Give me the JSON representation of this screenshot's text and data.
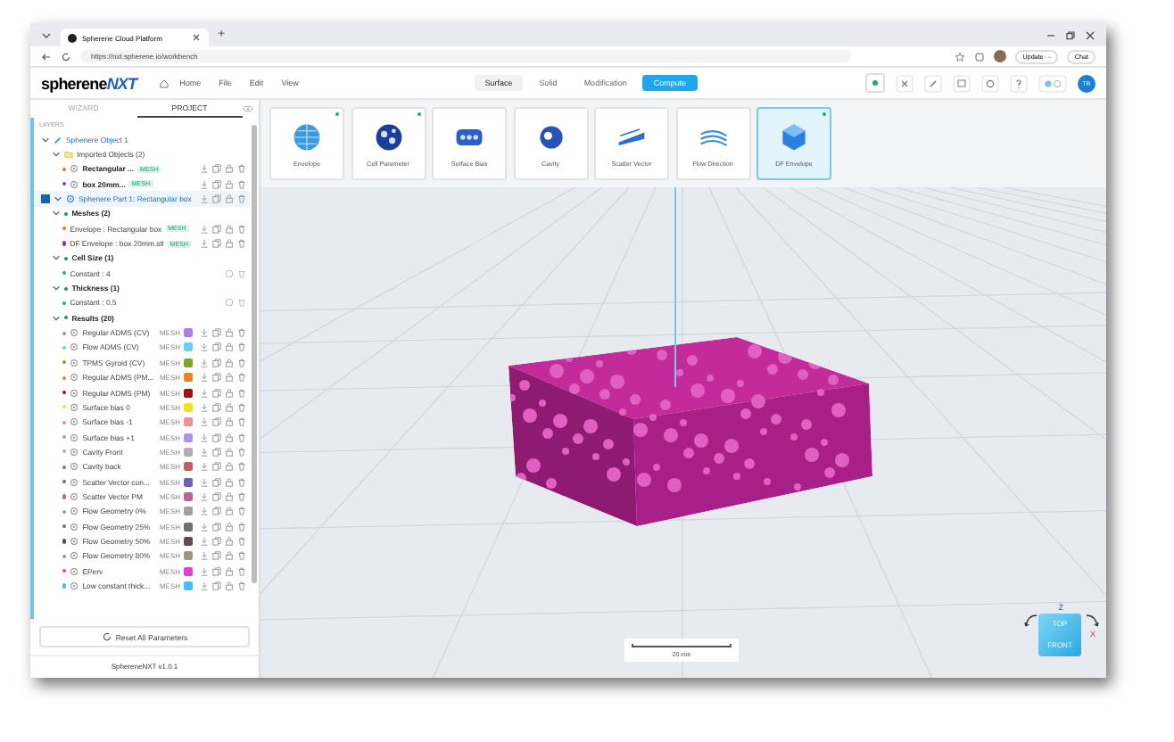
{
  "browser": {
    "tab_title": "Spherene Cloud Platform",
    "new_tab": "+",
    "url": "https://nxt.spherene.io/workbench",
    "update": "Update ···",
    "chat": "Chat"
  },
  "header": {
    "logo_main": "spherene",
    "logo_accent": "NXT",
    "menu": [
      "Home",
      "File",
      "Edit",
      "View"
    ],
    "modes": [
      {
        "label": "Surface",
        "selected": true,
        "kind": "tab"
      },
      {
        "label": "Solid",
        "selected": false,
        "kind": "tab"
      },
      {
        "label": "Modification",
        "selected": false,
        "kind": "tab"
      },
      {
        "label": "Compute",
        "selected": false,
        "kind": "action"
      }
    ],
    "status_online": true,
    "avatar": "TR"
  },
  "panel": {
    "tabs": [
      {
        "label": "WIZARD",
        "selected": false
      },
      {
        "label": "PROJECT",
        "selected": true
      }
    ],
    "section": "LAYERS",
    "tree": [
      {
        "kind": "object",
        "label": "Sphenere Object 1",
        "expanded": true,
        "children": [
          {
            "kind": "folder",
            "label": "Imported Objects (2)",
            "expanded": true,
            "children": [
              {
                "kind": "mesh",
                "label": "Rectangular ...",
                "badge": "MESH",
                "color": "#f07020"
              },
              {
                "kind": "mesh",
                "label": "box 20mm...",
                "badge": "MESH",
                "color": "#9030e0"
              }
            ]
          }
        ]
      },
      {
        "kind": "part",
        "label": "Sphenere Part 1: Rectangular box",
        "checked": true,
        "expanded": true,
        "children": [
          {
            "kind": "group",
            "label": "Meshes (2)",
            "expanded": true,
            "children": [
              {
                "kind": "source",
                "label": "Envelope : Rectangular box",
                "badge": "MESH",
                "color": "#f07020"
              },
              {
                "kind": "source",
                "label": "DF Envelope : box 20mm.stl",
                "badge": "MESH",
                "color": "#9030e0"
              }
            ]
          },
          {
            "kind": "group",
            "label": "Cell Size (1)",
            "expanded": true,
            "children": [
              {
                "kind": "param",
                "label": "Constant : 4"
              }
            ]
          },
          {
            "kind": "group",
            "label": "Thickness (1)",
            "expanded": true,
            "children": [
              {
                "kind": "param",
                "label": "Constant : 0.5"
              }
            ]
          },
          {
            "kind": "group",
            "label": "Results (20)",
            "expanded": true,
            "children": [
              {
                "kind": "result",
                "label": "Regular ADMS (CV)",
                "badge": "MESH",
                "color": "#b27be8"
              },
              {
                "kind": "result",
                "label": "Flow ADMS (CV)",
                "badge": "MESH",
                "color": "#6ecff6"
              },
              {
                "kind": "result",
                "label": "TPMS Gyroid (CV)",
                "badge": "MESH",
                "color": "#7aa829"
              },
              {
                "kind": "result",
                "label": "Regular ADMS (PM...",
                "badge": "MESH",
                "color": "#f08030"
              },
              {
                "kind": "result",
                "label": "Regular ADMS (PM)",
                "badge": "MESH",
                "color": "#a01010"
              },
              {
                "kind": "result",
                "label": "Surface bias 0",
                "badge": "MESH",
                "color": "#f5e11a"
              },
              {
                "kind": "result",
                "label": "Surface bias -1",
                "badge": "MESH",
                "color": "#f09090"
              },
              {
                "kind": "result",
                "label": "Surface bias +1",
                "badge": "MESH",
                "color": "#b090f0"
              },
              {
                "kind": "result",
                "label": "Cavity Front",
                "badge": "MESH",
                "color": "#b0b0b8"
              },
              {
                "kind": "result",
                "label": "Cavity back",
                "badge": "MESH",
                "color": "#c06060"
              },
              {
                "kind": "result",
                "label": "Scatter Vector con...",
                "badge": "MESH",
                "color": "#7060c0"
              },
              {
                "kind": "result",
                "label": "Scatter Vector PM",
                "badge": "MESH",
                "color": "#c0609a"
              },
              {
                "kind": "result",
                "label": "Flow Geometry 0%",
                "badge": "MESH",
                "color": "#a0a0a0"
              },
              {
                "kind": "result",
                "label": "Flow Geometry 25%",
                "badge": "MESH",
                "color": "#707070"
              },
              {
                "kind": "result",
                "label": "Flow Geometry 50%",
                "badge": "MESH",
                "color": "#6a4a4a"
              },
              {
                "kind": "result",
                "label": "Flow Geometry 80%",
                "badge": "MESH",
                "color": "#9a9a7a"
              },
              {
                "kind": "result",
                "label": "EPerv",
                "badge": "MESH",
                "color": "#e040d0"
              },
              {
                "kind": "result",
                "label": "Low constant thick...",
                "badge": "MESH",
                "color": "#40c0f0"
              }
            ]
          }
        ]
      }
    ],
    "reset": "Reset All Parameters",
    "version": "SphereneNXT v1.0.1"
  },
  "tools": [
    {
      "label": "Envelope",
      "ready": true,
      "selected": false
    },
    {
      "label": "Cell Parameter",
      "ready": true,
      "selected": false
    },
    {
      "label": "Surface Bias",
      "ready": false,
      "selected": false
    },
    {
      "label": "Cavity",
      "ready": false,
      "selected": false
    },
    {
      "label": "Scatter Vector",
      "ready": false,
      "selected": false
    },
    {
      "label": "Flow Direction",
      "ready": false,
      "selected": false
    },
    {
      "label": "DF Envelope",
      "ready": true,
      "selected": true
    }
  ],
  "viewport": {
    "scale": "20 mm",
    "cube_top": "TOP",
    "cube_front": "FRONT",
    "axis_z": "Z",
    "axis_x": "X"
  }
}
